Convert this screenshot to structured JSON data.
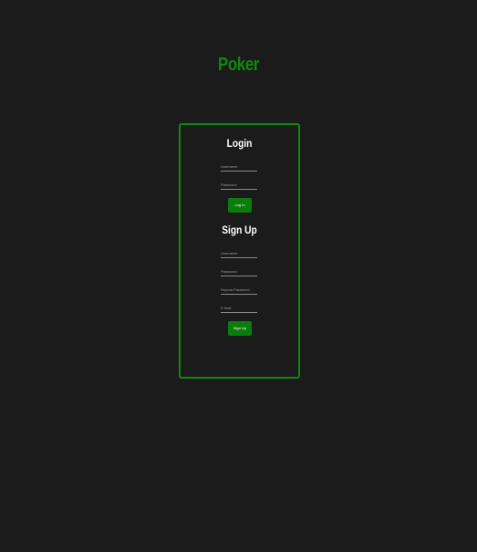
{
  "app": {
    "title": "Poker"
  },
  "login": {
    "heading": "Login",
    "username_placeholder": "Username",
    "password_placeholder": "Password",
    "submit_label": "Log In"
  },
  "signup": {
    "heading": "Sign Up",
    "username_placeholder": "Username",
    "password_placeholder": "Password",
    "repeat_password_placeholder": "Repeat Password",
    "email_placeholder": "E-Mail",
    "submit_label": "Sign Up"
  },
  "colors": {
    "background": "#1b1b1b",
    "accent": "#0b8a0b",
    "text": "#ffffff"
  }
}
